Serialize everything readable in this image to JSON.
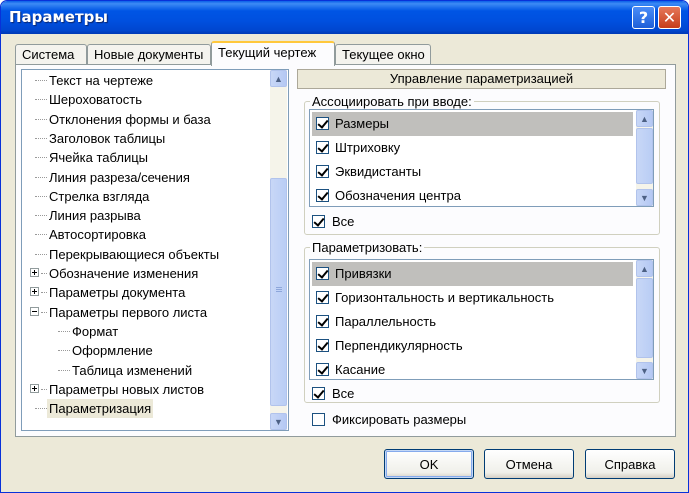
{
  "window": {
    "title": "Параметры"
  },
  "title_buttons": {
    "help": "?",
    "close": "✕"
  },
  "tabs": [
    {
      "label": "Система",
      "active": false
    },
    {
      "label": "Новые документы",
      "active": false
    },
    {
      "label": "Текущий чертеж",
      "active": true
    },
    {
      "label": "Текущее окно",
      "active": false
    }
  ],
  "tree": {
    "items": [
      {
        "label": "Текст на чертеже",
        "level": 1,
        "expander": "none",
        "selected": false
      },
      {
        "label": "Шероховатость",
        "level": 1,
        "expander": "none",
        "selected": false
      },
      {
        "label": "Отклонения формы и база",
        "level": 1,
        "expander": "none",
        "selected": false
      },
      {
        "label": "Заголовок таблицы",
        "level": 1,
        "expander": "none",
        "selected": false
      },
      {
        "label": "Ячейка таблицы",
        "level": 1,
        "expander": "none",
        "selected": false
      },
      {
        "label": "Линия разреза/сечения",
        "level": 1,
        "expander": "none",
        "selected": false
      },
      {
        "label": "Стрелка взгляда",
        "level": 1,
        "expander": "none",
        "selected": false
      },
      {
        "label": "Линия разрыва",
        "level": 1,
        "expander": "none",
        "selected": false
      },
      {
        "label": "Автосортировка",
        "level": 1,
        "expander": "none",
        "selected": false
      },
      {
        "label": "Перекрывающиеся объекты",
        "level": 1,
        "expander": "none",
        "selected": false
      },
      {
        "label": "Обозначение изменения",
        "level": 1,
        "expander": "plus",
        "selected": false
      },
      {
        "label": "Параметры документа",
        "level": 1,
        "expander": "plus",
        "selected": false
      },
      {
        "label": "Параметры первого листа",
        "level": 1,
        "expander": "minus",
        "selected": false
      },
      {
        "label": "Формат",
        "level": 2,
        "expander": "none",
        "selected": false
      },
      {
        "label": "Оформление",
        "level": 2,
        "expander": "none",
        "selected": false
      },
      {
        "label": "Таблица изменений",
        "level": 2,
        "expander": "none",
        "selected": false
      },
      {
        "label": "Параметры новых листов",
        "level": 1,
        "expander": "plus",
        "selected": false
      },
      {
        "label": "Параметризация",
        "level": 1,
        "expander": "none",
        "selected": true
      }
    ]
  },
  "panel": {
    "header": "Управление параметризацией",
    "associate": {
      "title": "Ассоциировать при вводе:",
      "items": [
        {
          "label": "Размеры",
          "checked": true,
          "selected": true
        },
        {
          "label": "Штриховку",
          "checked": true,
          "selected": false
        },
        {
          "label": "Эквидистанты",
          "checked": true,
          "selected": false
        },
        {
          "label": "Обозначения центра",
          "checked": true,
          "selected": false
        }
      ],
      "all_label": "Все",
      "all_checked": true
    },
    "parametrize": {
      "title": "Параметризовать:",
      "items": [
        {
          "label": "Привязки",
          "checked": true,
          "selected": true
        },
        {
          "label": "Горизонтальность и вертикальность",
          "checked": true,
          "selected": false
        },
        {
          "label": "Параллельность",
          "checked": true,
          "selected": false
        },
        {
          "label": "Перпендикулярность",
          "checked": true,
          "selected": false
        },
        {
          "label": "Касание",
          "checked": true,
          "selected": false
        }
      ],
      "all_label": "Все",
      "all_checked": true
    },
    "fix_sizes": {
      "label": "Фиксировать размеры",
      "checked": false
    }
  },
  "buttons": {
    "ok": "OK",
    "cancel": "Отмена",
    "help": "Справка"
  }
}
